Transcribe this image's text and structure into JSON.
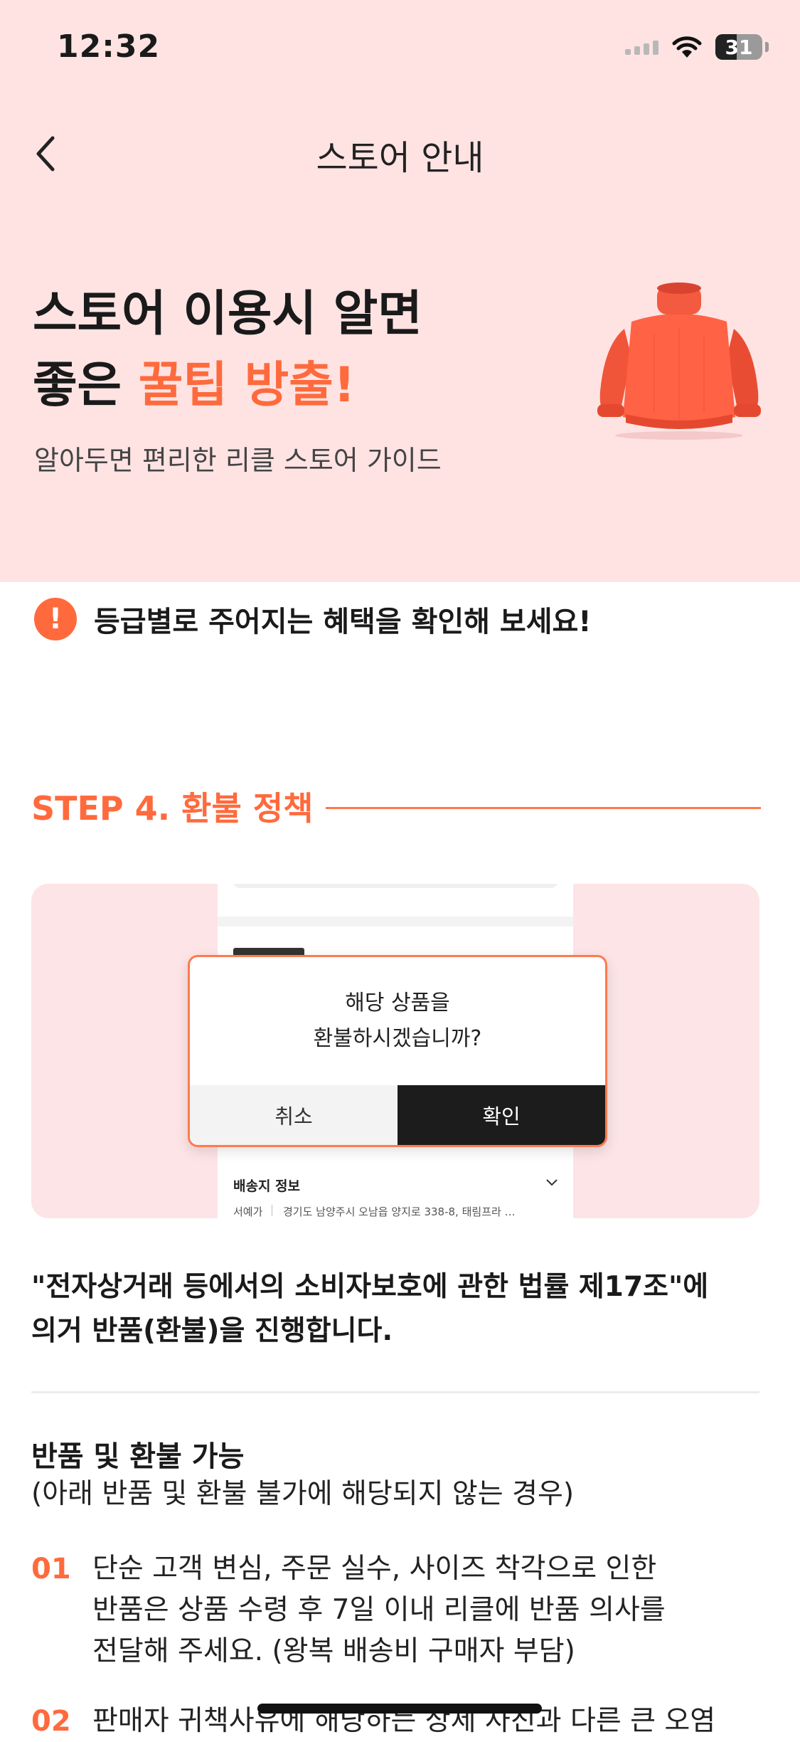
{
  "status": {
    "time": "12:32",
    "battery": "31"
  },
  "nav": {
    "title": "스토어 안내"
  },
  "hero": {
    "title_line1": "스토어 이용시 알면",
    "title_line2_pre": "좋은 ",
    "title_line2_accent": "꿀팁 방출!",
    "subtitle": "알아두면 편리한 리클 스토어 가이드"
  },
  "notice": {
    "icon": "!",
    "text": "등급별로 주어지는 혜택을 확인해 보세요!"
  },
  "step": {
    "title": "STEP 4. 환불 정책"
  },
  "illustration": {
    "dialog_line1": "해당 상품을",
    "dialog_line2": "환불하시겠습니까?",
    "cancel": "취소",
    "confirm": "확인",
    "shipping_label": "배송지 정보",
    "shipping_name": "서예가",
    "shipping_address": "경기도 남양주시 오남읍 양지로 338-8, 태림프라 …"
  },
  "law": {
    "line1": "\"전자상거래 등에서의 소비자보호에 관한 법률 제17조\"에",
    "line2": "의거 반품(환불)을 진행합니다."
  },
  "section": {
    "title": "반품 및 환불 가능",
    "subtitle": "(아래 반품 및 환불 불가에 해당되지 않는 경우)"
  },
  "items": [
    {
      "num": "01",
      "line1": "단순 고객 변심, 주문 실수, 사이즈 착각으로 인한",
      "line2": "반품은 상품 수령 후 7일 이내 리클에 반품 의사를",
      "line3": "전달해 주세요. (왕복 배송비 구매자 부담)"
    },
    {
      "num": "02",
      "line1": "판매자 귀책사유에 해당하는 상세 사진과 다른 큰 오염"
    }
  ],
  "colors": {
    "accent": "#ff6a3d",
    "hero_bg": "#ffe3e3",
    "illus_bg": "#fde4e6"
  }
}
